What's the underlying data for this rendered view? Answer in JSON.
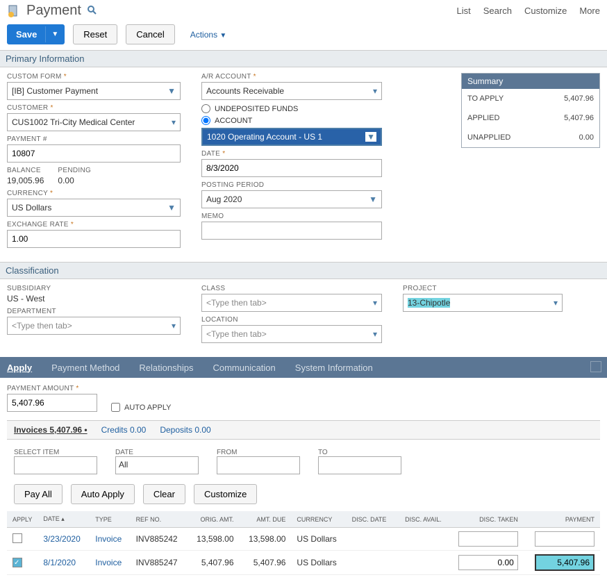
{
  "header": {
    "title": "Payment",
    "links": [
      "List",
      "Search",
      "Customize",
      "More"
    ]
  },
  "toolbar": {
    "save": "Save",
    "reset": "Reset",
    "cancel": "Cancel",
    "actions": "Actions"
  },
  "sections": {
    "primary": "Primary Information",
    "classification": "Classification"
  },
  "primary": {
    "custom_form_label": "CUSTOM FORM",
    "custom_form": "[IB] Customer Payment",
    "customer_label": "CUSTOMER",
    "customer": "CUS1002 Tri-City Medical Center",
    "payment_no_label": "PAYMENT #",
    "payment_no": "10807",
    "balance_label": "BALANCE",
    "balance": "19,005.96",
    "pending_label": "PENDING",
    "pending": "0.00",
    "currency_label": "CURRENCY",
    "currency": "US Dollars",
    "exchange_label": "EXCHANGE RATE",
    "exchange": "1.00",
    "ar_label": "A/R ACCOUNT",
    "ar_account": "Accounts Receivable",
    "undeposited_label": "UNDEPOSITED FUNDS",
    "account_label": "ACCOUNT",
    "account": "1020 Operating Account - US 1",
    "date_label": "DATE",
    "date": "8/3/2020",
    "posting_label": "POSTING PERIOD",
    "posting": "Aug 2020",
    "memo_label": "MEMO",
    "memo": ""
  },
  "summary": {
    "title": "Summary",
    "to_apply_label": "TO APPLY",
    "to_apply": "5,407.96",
    "applied_label": "APPLIED",
    "applied": "5,407.96",
    "unapplied_label": "UNAPPLIED",
    "unapplied": "0.00"
  },
  "classification": {
    "subsidiary_label": "SUBSIDIARY",
    "subsidiary": "US - West",
    "department_label": "DEPARTMENT",
    "department": "<Type then tab>",
    "class_label": "CLASS",
    "class": "<Type then tab>",
    "location_label": "LOCATION",
    "location": "<Type then tab>",
    "project_label": "PROJECT",
    "project": "13-Chipotle"
  },
  "tabs": [
    "Apply",
    "Payment Method",
    "Relationships",
    "Communication",
    "System Information"
  ],
  "apply": {
    "payment_amount_label": "PAYMENT AMOUNT",
    "payment_amount": "5,407.96",
    "auto_apply_label": "AUTO APPLY",
    "subtabs": {
      "invoices": "Invoices 5,407.96",
      "credits": "Credits 0.00",
      "deposits": "Deposits 0.00"
    },
    "filters": {
      "select_item": "SELECT ITEM",
      "date": "DATE",
      "date_val": "All",
      "from": "FROM",
      "to": "TO"
    },
    "buttons": {
      "pay_all": "Pay All",
      "auto_apply": "Auto Apply",
      "clear": "Clear",
      "customize": "Customize"
    },
    "grid": {
      "headers": {
        "apply": "APPLY",
        "date": "DATE ▴",
        "type": "TYPE",
        "refno": "REF NO.",
        "orig": "ORIG. AMT.",
        "due": "AMT. DUE",
        "curr": "CURRENCY",
        "discdate": "DISC. DATE",
        "discavail": "DISC. AVAIL.",
        "disctaken": "DISC. TAKEN",
        "payment": "PAYMENT"
      },
      "rows": [
        {
          "checked": false,
          "date": "3/23/2020",
          "type": "Invoice",
          "ref": "INV885242",
          "orig": "13,598.00",
          "due": "13,598.00",
          "curr": "US Dollars",
          "disc_taken": "",
          "payment": ""
        },
        {
          "checked": true,
          "date": "8/1/2020",
          "type": "Invoice",
          "ref": "INV885247",
          "orig": "5,407.96",
          "due": "5,407.96",
          "curr": "US Dollars",
          "disc_taken": "0.00",
          "payment": "5,407.96"
        }
      ]
    }
  }
}
